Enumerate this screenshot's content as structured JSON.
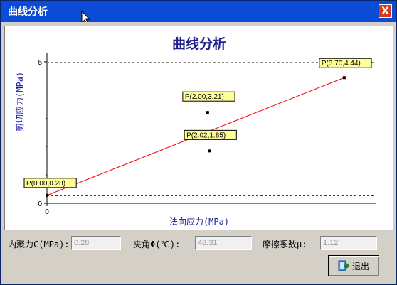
{
  "window": {
    "title": "曲线分析",
    "close_label": "X"
  },
  "chart_data": {
    "type": "line",
    "title": "曲线分析",
    "xlabel": "法向应力(MPa)",
    "ylabel": "剪切应力(MPa)",
    "xlim": [
      0,
      4.1
    ],
    "ylim": [
      0,
      5.3
    ],
    "yticks": [
      "0",
      "5"
    ],
    "xticks": [
      "0"
    ],
    "reference_lines": [
      5,
      0.28
    ],
    "points": [
      {
        "x": 0.0,
        "y": 0.28,
        "label": "P(0.00,0.28)"
      },
      {
        "x": 2.0,
        "y": 3.21,
        "label": "P(2.00,3.21)"
      },
      {
        "x": 2.02,
        "y": 1.85,
        "label": "P(2.02,1.85)"
      },
      {
        "x": 3.7,
        "y": 4.44,
        "label": "P(3.70,4.44)"
      }
    ],
    "fit_line": {
      "x": [
        0.0,
        3.7
      ],
      "y": [
        0.28,
        4.44
      ],
      "color": "#ff0000"
    },
    "colors": {
      "title": "#1f1f8a",
      "axis_label": "#1a1aa0",
      "label_bg": "#ffff99",
      "fit": "#ff0000"
    }
  },
  "results": {
    "cohesion_label": "内聚力C(MPa):",
    "cohesion_value": "0.28",
    "angle_label": "夹角Φ(℃):",
    "angle_value": "48.31",
    "friction_label": "摩擦系数μ:",
    "friction_value": "1.12"
  },
  "exit_button": {
    "label": "退出",
    "icon": "exit-icon"
  }
}
